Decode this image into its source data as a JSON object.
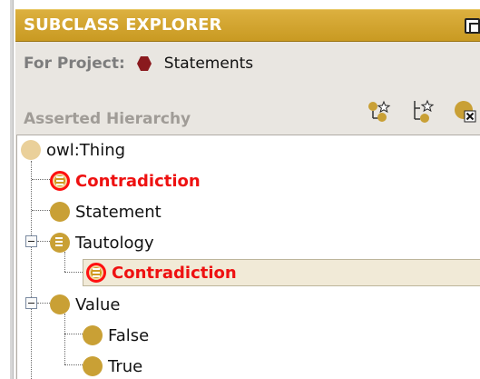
{
  "titlebar": {
    "title": "SUBCLASS EXPLORER",
    "icon": "window-maximize-icon"
  },
  "project": {
    "label": "For Project:",
    "icon": "project-hexagon-icon",
    "name": "Statements"
  },
  "hierarchy": {
    "label": "Asserted Hierarchy",
    "tools": [
      "create-subclass-icon",
      "create-sibling-class-icon",
      "delete-class-icon"
    ]
  },
  "tree": {
    "rows": [
      {
        "label": "owl:Thing",
        "icon": "class-icon",
        "state": "normal"
      },
      {
        "label": "Contradiction",
        "icon": "inconsistent-defined-class-icon",
        "state": "error"
      },
      {
        "label": "Statement",
        "icon": "class-icon",
        "state": "normal"
      },
      {
        "label": "Tautology",
        "icon": "defined-class-icon",
        "state": "expanded"
      },
      {
        "label": "Contradiction",
        "icon": "inconsistent-defined-class-icon",
        "state": "error-selected"
      },
      {
        "label": "Value",
        "icon": "class-icon",
        "state": "expanded"
      },
      {
        "label": "False",
        "icon": "class-icon",
        "state": "normal"
      },
      {
        "label": "True",
        "icon": "class-icon",
        "state": "normal"
      }
    ]
  },
  "colors": {
    "accent": "#c99a22",
    "error": "#ee1111",
    "selection": "#f1ead7",
    "class_node": "#c9a035"
  }
}
